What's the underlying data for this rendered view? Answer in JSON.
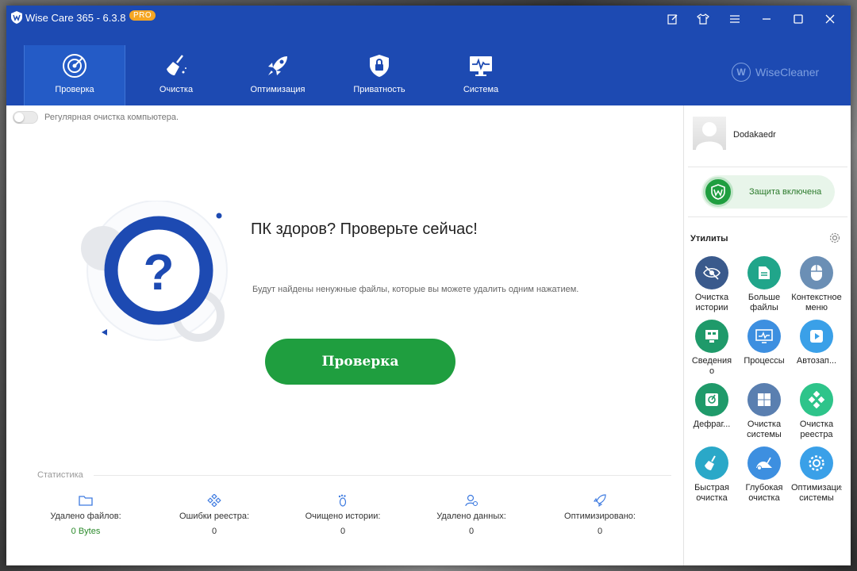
{
  "app": {
    "title": "Wise Care 365 - 6.3.8",
    "badge": "PRO"
  },
  "nav": [
    {
      "label": "Проверка",
      "icon": "radar-icon",
      "active": true
    },
    {
      "label": "Очистка",
      "icon": "broom-icon",
      "active": false
    },
    {
      "label": "Оптимизация",
      "icon": "rocket-icon",
      "active": false
    },
    {
      "label": "Приватность",
      "icon": "lock-icon",
      "active": false
    },
    {
      "label": "Система",
      "icon": "monitor-icon",
      "active": false
    }
  ],
  "brand": "WiseCleaner",
  "main": {
    "toggle_label": "Регулярная очистка компьютера.",
    "hero_title": "ПК здоров? Проверьте сейчас!",
    "hero_subtitle": "Будут найдены ненужные файлы, которые вы можете удалить одним нажатием.",
    "scan_button": "Проверка"
  },
  "stats": {
    "title": "Статистика",
    "items": [
      {
        "label": "Удалено файлов:",
        "value": "0 Bytes",
        "icon": "folder-icon"
      },
      {
        "label": "Ошибки реестра:",
        "value": "0",
        "icon": "registry-icon"
      },
      {
        "label": "Очищено истории:",
        "value": "0",
        "icon": "footprint-icon"
      },
      {
        "label": "Удалено данных:",
        "value": "0",
        "icon": "user-data-icon"
      },
      {
        "label": "Оптимизировано:",
        "value": "0",
        "icon": "rocket-small-icon"
      }
    ]
  },
  "sidebar": {
    "user_name": "Dodakaedr",
    "protection_label": "Защита включена",
    "utilities_title": "Утилиты",
    "tools": [
      {
        "label": "Очистка\nистории",
        "icon": "eye-off-icon",
        "color": "#3a5a8c"
      },
      {
        "label": "Больше\nфайлы",
        "icon": "files-icon",
        "color": "#20a58a"
      },
      {
        "label": "Контекстное\nменю",
        "icon": "mouse-icon",
        "color": "#6b8fb5"
      },
      {
        "label": "Сведения\nо",
        "icon": "system-info-icon",
        "color": "#1f9a6a"
      },
      {
        "label": "Процессы",
        "icon": "processes-icon",
        "color": "#3d8fe0"
      },
      {
        "label": "Автозап...",
        "icon": "startup-icon",
        "color": "#3aa0e8"
      },
      {
        "label": "Дефраг...",
        "icon": "defrag-icon",
        "color": "#1f9a6a"
      },
      {
        "label": "Очистка\nсистемы",
        "icon": "windows-icon",
        "color": "#5a7fb0"
      },
      {
        "label": "Очистка\nреестра",
        "icon": "registry-clean-icon",
        "color": "#2ec48a"
      },
      {
        "label": "Быстрая\nочистка",
        "icon": "fast-clean-icon",
        "color": "#2aa8c8"
      },
      {
        "label": "Глубокая\nочистка",
        "icon": "deep-clean-icon",
        "color": "#3d8fe0"
      },
      {
        "label": "Оптимизация\nсистемы",
        "icon": "optimize-icon",
        "color": "#3aa0e8"
      }
    ]
  }
}
